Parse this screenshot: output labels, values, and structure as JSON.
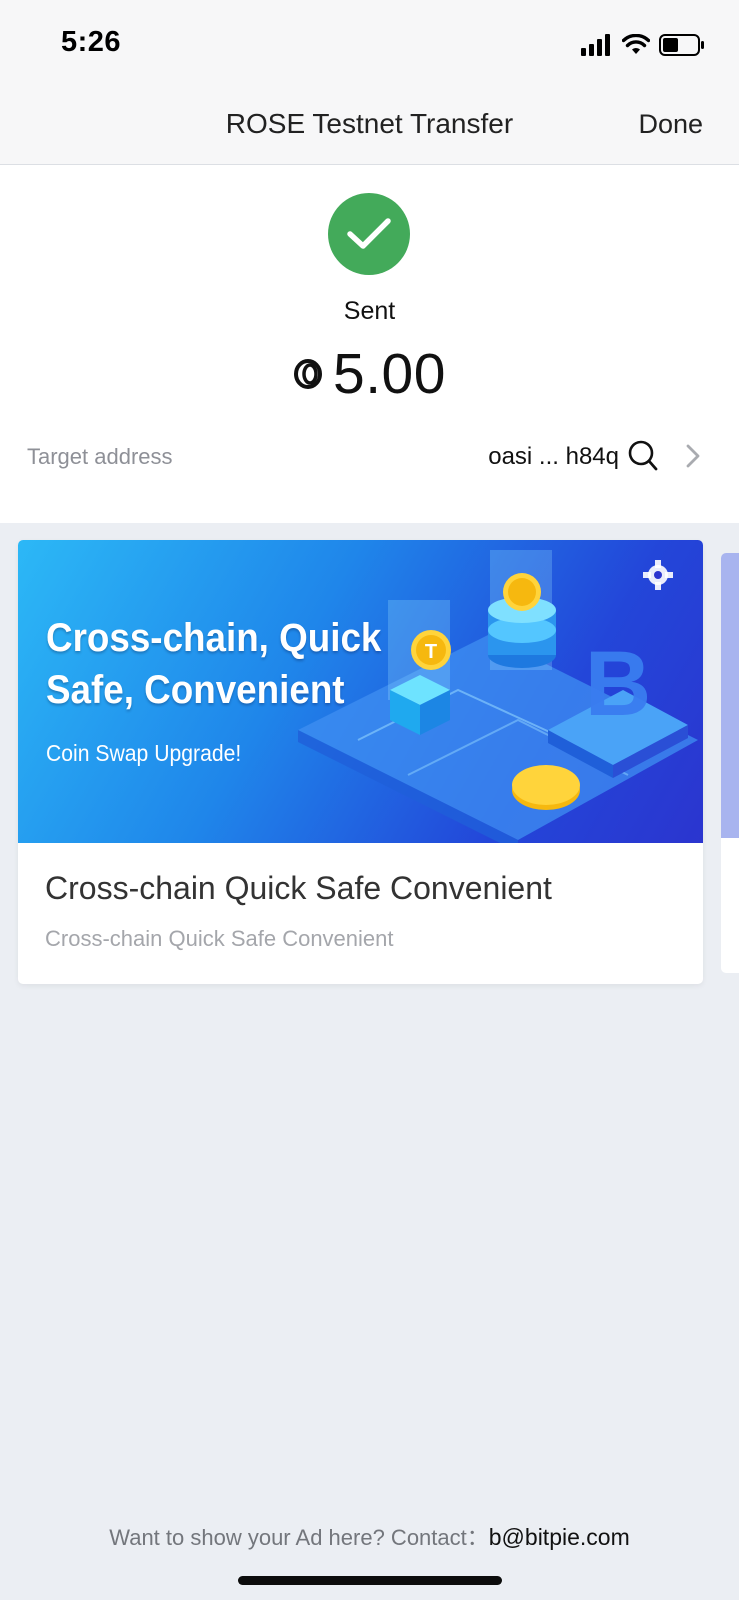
{
  "status_bar": {
    "time": "5:26"
  },
  "nav": {
    "title": "ROSE Testnet Transfer",
    "done_label": "Done"
  },
  "result": {
    "status_label": "Sent",
    "amount": "5.00",
    "address_label": "Target address",
    "address_value": "oasi ... h84q"
  },
  "ad_card": {
    "banner_headline_line1": "Cross-chain, Quick",
    "banner_headline_line2": "Safe, Convenient",
    "banner_subline": "Coin Swap Upgrade!",
    "title": "Cross-chain Quick Safe Convenient",
    "subtitle": "Cross-chain Quick Safe Convenient"
  },
  "footer": {
    "prompt": "Want to show your Ad here? Contact：",
    "email": "b@bitpie.com"
  },
  "colors": {
    "success_green": "#43aa5a",
    "banner_blue": "#1f86ea",
    "background": "#ebeef3"
  },
  "icons": [
    "signal-icon",
    "wifi-icon",
    "battery-icon",
    "check-icon",
    "rose-token-icon",
    "search-icon",
    "chevron-right-icon",
    "gear-icon"
  ]
}
